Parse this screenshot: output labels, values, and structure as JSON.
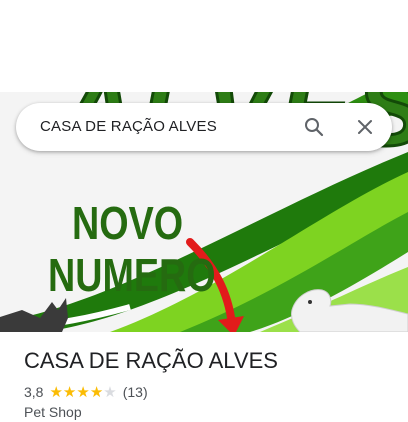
{
  "search": {
    "query": "CASA DE RAÇÃO ALVES",
    "search_icon": "search-icon",
    "close_icon": "close-icon"
  },
  "hero": {
    "brand_word": "ALVES",
    "promo_line_1": "NOVO",
    "promo_line_2": "NUMERO",
    "colors": {
      "green_dark": "#256b10",
      "green_light": "#7ed321",
      "arrow": "#e21b1b"
    }
  },
  "place": {
    "name": "CASA DE RAÇÃO ALVES",
    "rating": "3,8",
    "rating_value": 3.8,
    "max_stars": 5,
    "review_count": "(13)",
    "category": "Pet Shop"
  }
}
